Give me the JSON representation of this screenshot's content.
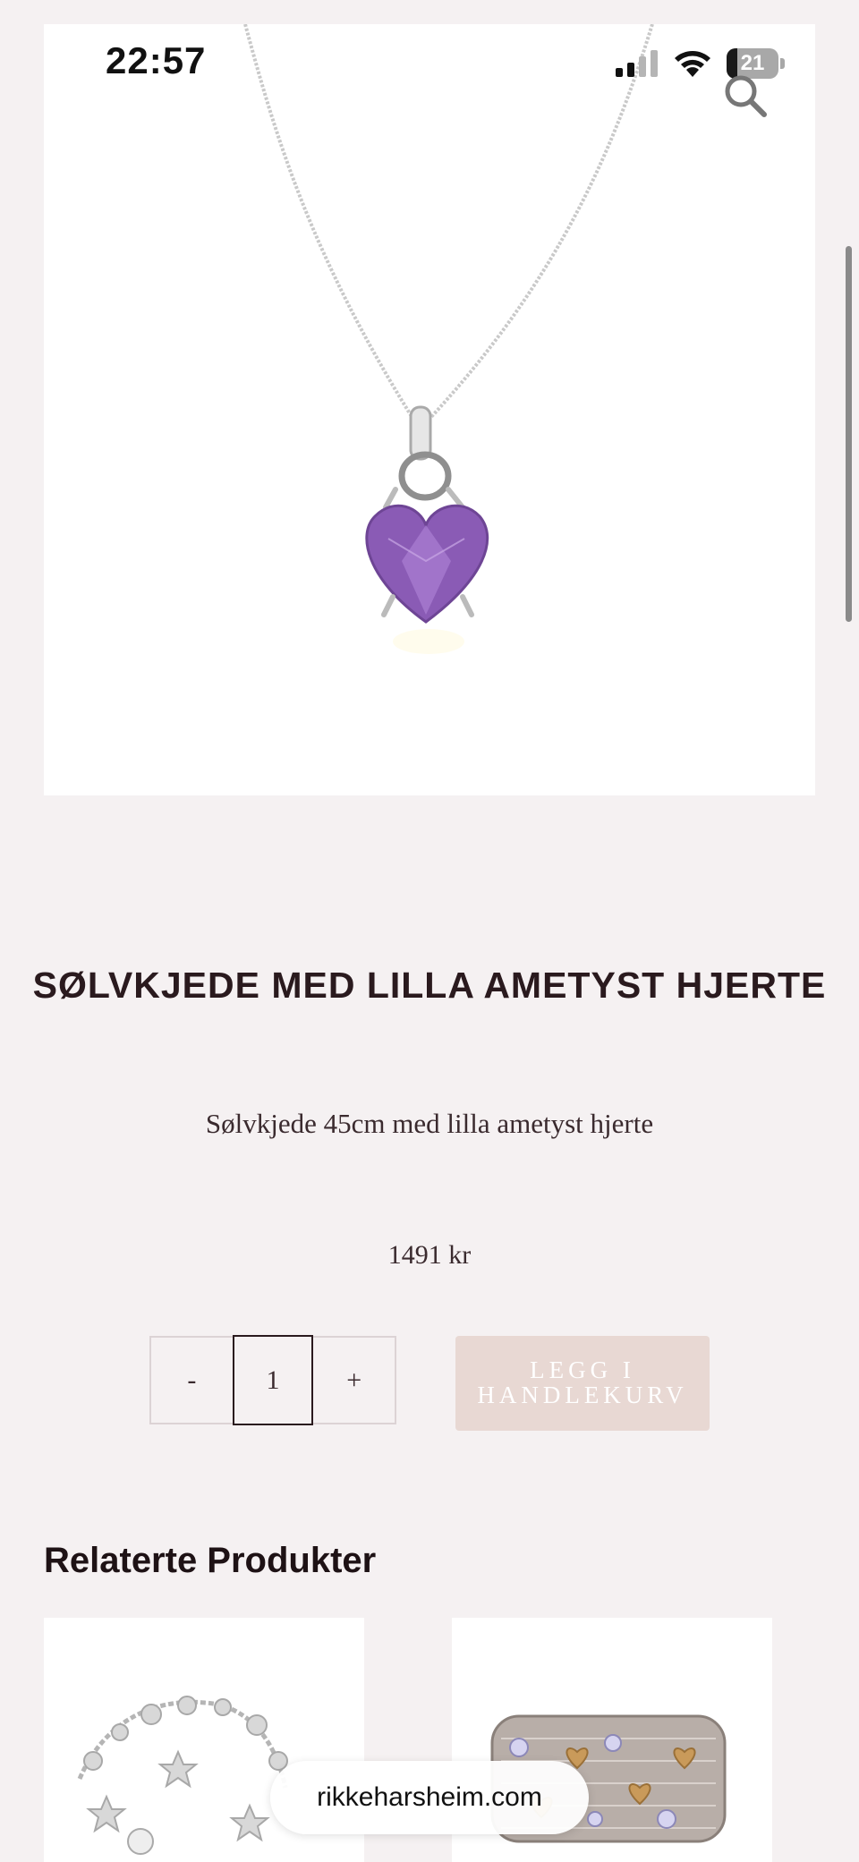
{
  "status_bar": {
    "time": "22:57",
    "battery_level": "21",
    "icons": [
      "signal-icon",
      "wifi-icon",
      "battery-icon"
    ]
  },
  "header": {
    "search_icon": "search-icon"
  },
  "product": {
    "image_alt": "Sølvkjede med lilla ametyst hjerte",
    "title": "SØLVKJEDE MED LILLA AMETYST HJERTE",
    "description": "Sølvkjede 45cm med lilla ametyst hjerte",
    "price": "1491 kr",
    "quantity": {
      "decrement_label": "-",
      "value": "1",
      "increment_label": "+"
    },
    "add_to_cart_label": "LEGG I HANDLEKURV"
  },
  "related": {
    "heading": "Relaterte Produkter",
    "items": [
      {
        "image": "silver-star-bracelet"
      },
      {
        "image": "chainmail-ring-with-gems"
      }
    ]
  },
  "browser": {
    "url": "rikkeharsheim.com"
  },
  "colors": {
    "background": "#f5f1f2",
    "text": "#2a1a1e",
    "button_bg": "#e8d8d3",
    "amethyst": "#8a5bb5"
  }
}
